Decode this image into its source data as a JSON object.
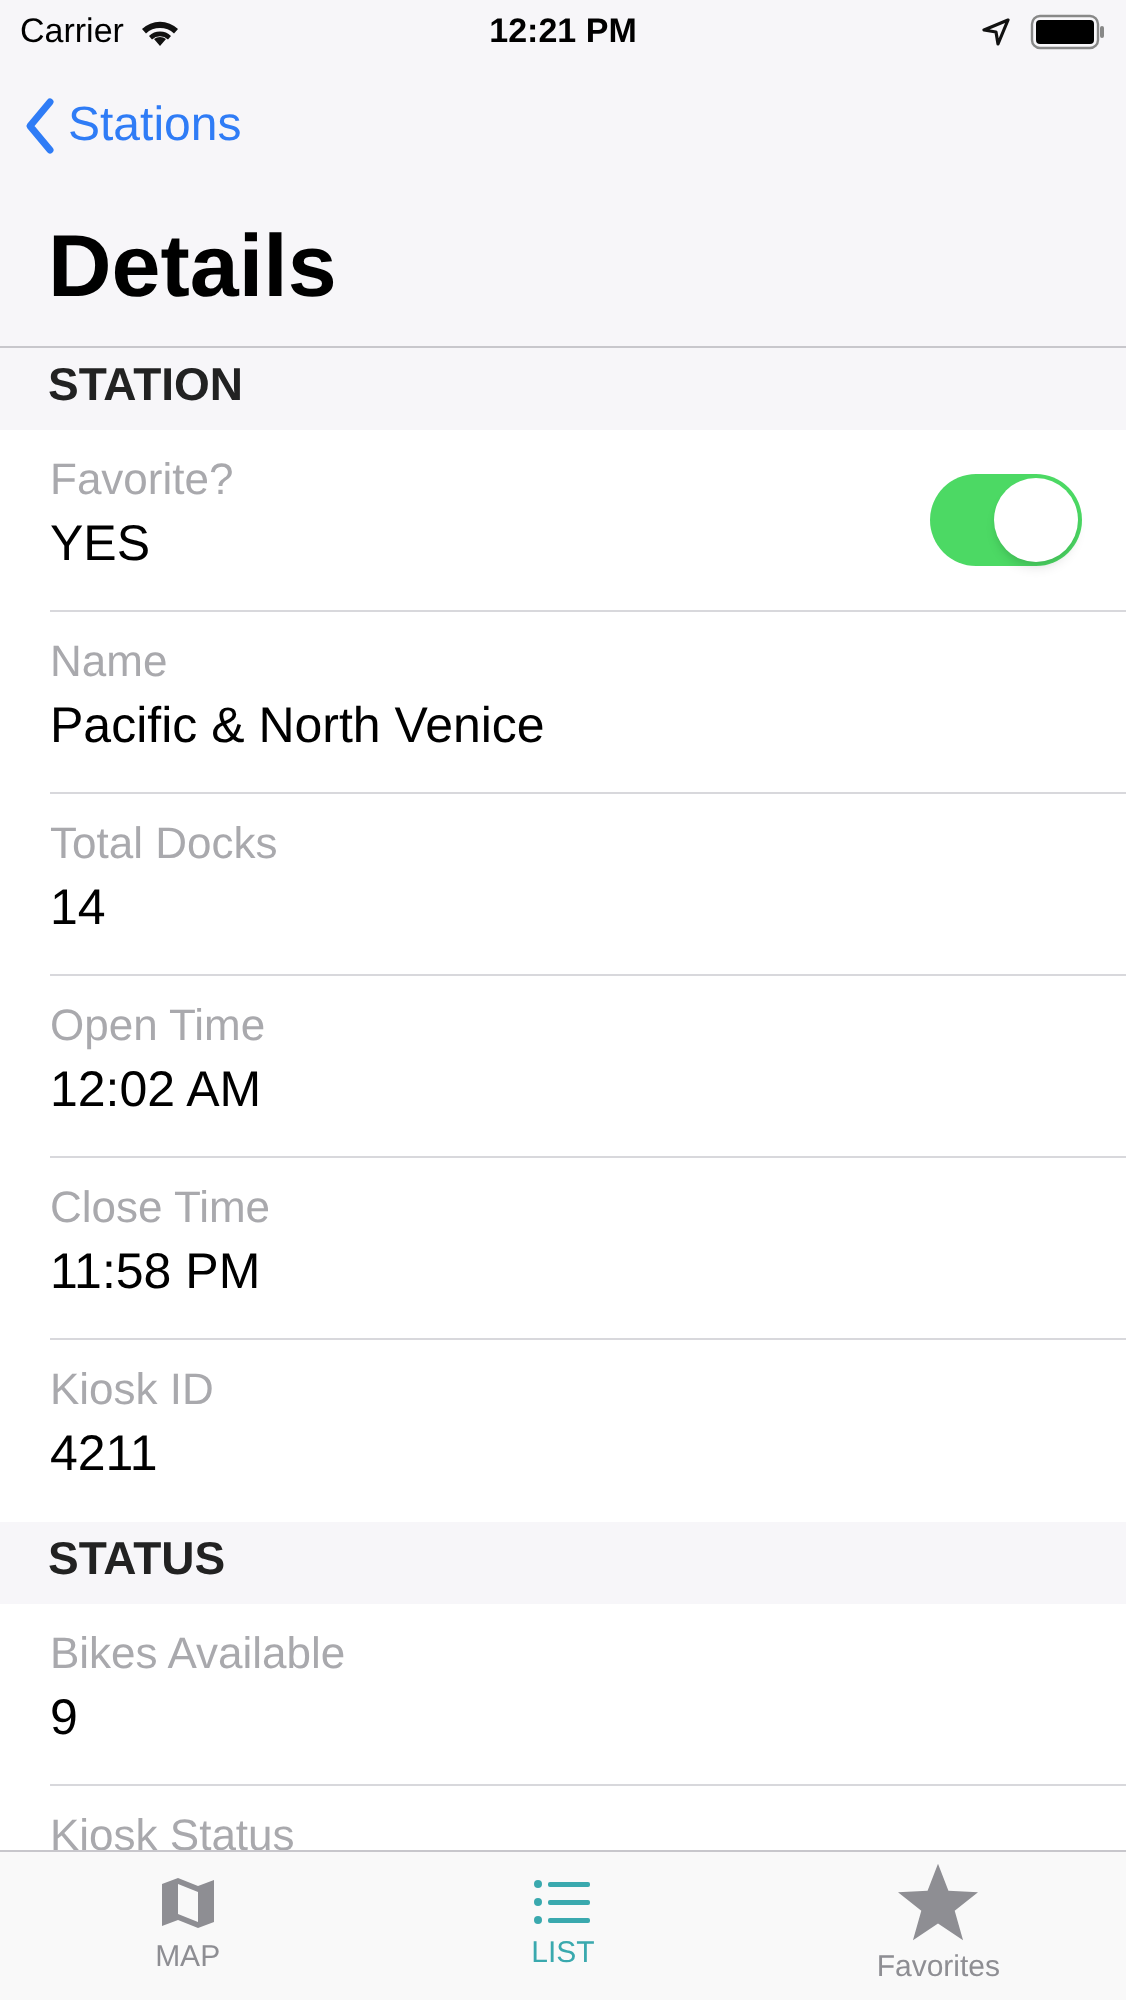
{
  "status_bar": {
    "carrier": "Carrier",
    "time": "12:21 PM"
  },
  "nav": {
    "back": "Stations",
    "title": "Details"
  },
  "sections": [
    {
      "header": "STATION",
      "rows": [
        {
          "kind": "toggle",
          "label": "Favorite?",
          "value": "YES",
          "on": true
        },
        {
          "kind": "text",
          "label": "Name",
          "value": "Pacific & North Venice"
        },
        {
          "kind": "text",
          "label": "Total Docks",
          "value": "14"
        },
        {
          "kind": "text",
          "label": "Open Time",
          "value": "12:02 AM"
        },
        {
          "kind": "text",
          "label": "Close Time",
          "value": "11:58 PM"
        },
        {
          "kind": "text",
          "label": "Kiosk ID",
          "value": "4211"
        }
      ]
    },
    {
      "header": "STATUS",
      "rows": [
        {
          "kind": "text",
          "label": "Bikes Available",
          "value": "9"
        },
        {
          "kind": "text",
          "label": "Kiosk Status"
        }
      ]
    }
  ],
  "tabs": [
    {
      "kind": "map",
      "label": "MAP",
      "selected": false
    },
    {
      "kind": "list",
      "label": "LIST",
      "selected": true
    },
    {
      "kind": "star",
      "label": "Favorites",
      "selected": false
    }
  ]
}
